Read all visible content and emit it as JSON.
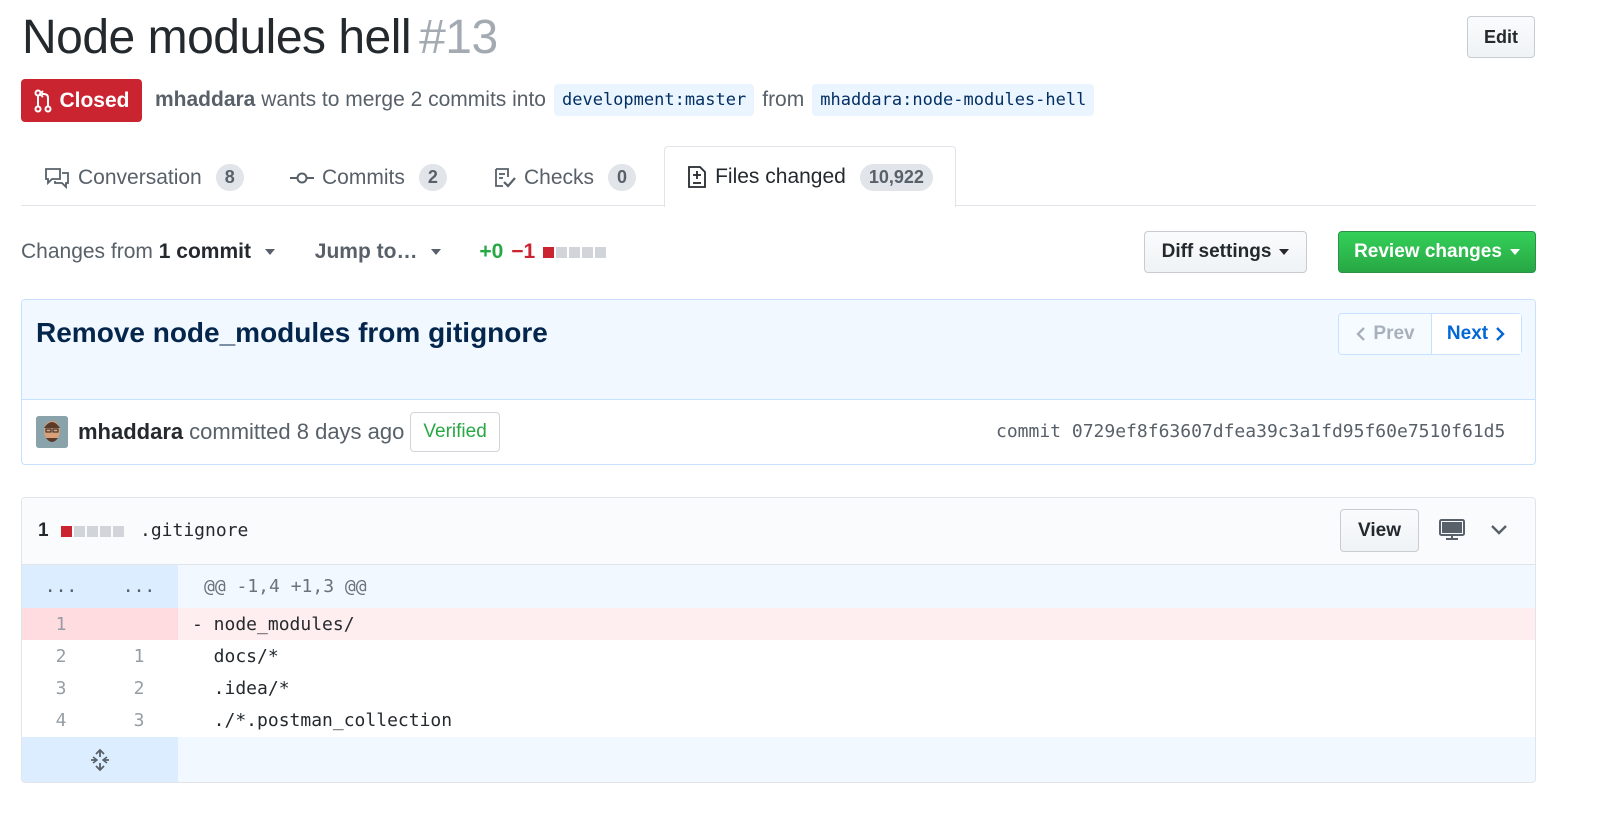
{
  "pr": {
    "title": "Node modules hell",
    "number": "#13",
    "edit_label": "Edit",
    "state": "Closed",
    "author": "mhaddara",
    "merge_text": "wants to merge 2 commits into",
    "base_branch": "development:master",
    "from_text": "from",
    "head_branch": "mhaddara:node-modules-hell"
  },
  "tabs": [
    {
      "label": "Conversation",
      "count": "8",
      "icon": "comment-discussion-icon"
    },
    {
      "label": "Commits",
      "count": "2",
      "icon": "git-commit-icon"
    },
    {
      "label": "Checks",
      "count": "0",
      "icon": "checklist-icon"
    },
    {
      "label": "Files changed",
      "count": "10,922",
      "icon": "file-diff-icon",
      "active": true
    }
  ],
  "toolbar": {
    "changes_from": "Changes from",
    "changes_count": "1 commit",
    "jump_to": "Jump to…",
    "additions": "+0",
    "deletions": "−1",
    "diff_settings": "Diff settings",
    "review_changes": "Review changes"
  },
  "commit": {
    "title": "Remove node_modules from gitignore",
    "prev": "Prev",
    "next": "Next",
    "author": "mhaddara",
    "committed": "committed 8 days ago",
    "verified": "Verified",
    "sha_label": "commit",
    "sha": "0729ef8f63607dfea39c3a1fd95f60e7510f61d5"
  },
  "file": {
    "change_count": "1",
    "name": ".gitignore",
    "view_label": "View",
    "hunk": {
      "old": "...",
      "new": "...",
      "header": "@@ -1,4 +1,3 @@"
    },
    "lines": [
      {
        "old": "1",
        "new": "",
        "code": "- node_modules/",
        "type": "deleted"
      },
      {
        "old": "2",
        "new": "1",
        "code": "  docs/*",
        "type": "context"
      },
      {
        "old": "3",
        "new": "2",
        "code": "  .idea/*",
        "type": "context"
      },
      {
        "old": "4",
        "new": "3",
        "code": "  ./*.postman_collection",
        "type": "context"
      }
    ]
  },
  "colors": {
    "closed": "#cb2431",
    "add": "#28a745",
    "del": "#cb2431",
    "link": "#0366d6",
    "review_green": "#2ea44f"
  }
}
